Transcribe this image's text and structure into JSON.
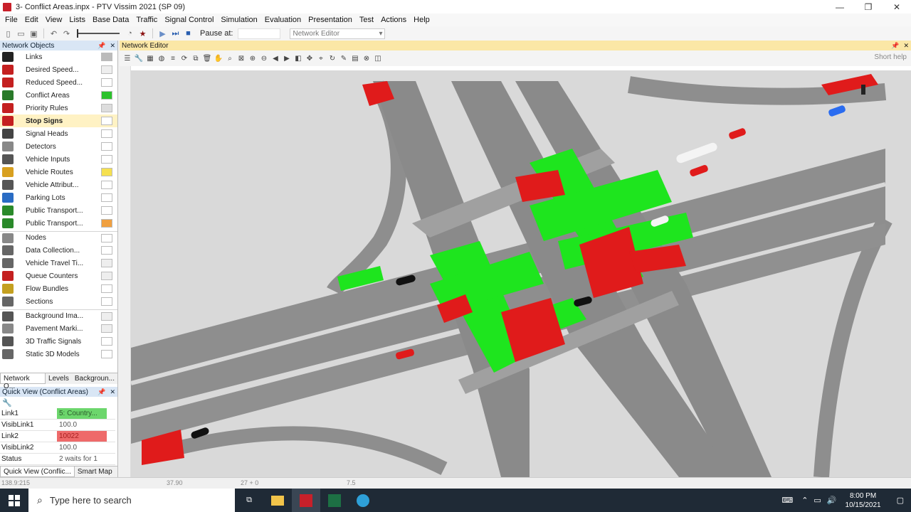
{
  "window": {
    "title": "3- Conflict Areas.inpx - PTV Vissim 2021 (SP 09)"
  },
  "menu": [
    "File",
    "Edit",
    "View",
    "Lists",
    "Base Data",
    "Traffic",
    "Signal Control",
    "Simulation",
    "Evaluation",
    "Presentation",
    "Test",
    "Actions",
    "Help"
  ],
  "toolbar": {
    "pause_label": "Pause at:",
    "editor_select": "Network Editor"
  },
  "network_objects": {
    "title": "Network Objects",
    "items": [
      {
        "label": "Links"
      },
      {
        "label": "Desired Speed..."
      },
      {
        "label": "Reduced Speed..."
      },
      {
        "label": "Conflict Areas"
      },
      {
        "label": "Priority Rules"
      },
      {
        "label": "Stop Signs"
      },
      {
        "label": "Signal Heads"
      },
      {
        "label": "Detectors"
      },
      {
        "label": "Vehicle Inputs"
      },
      {
        "label": "Vehicle Routes"
      },
      {
        "label": "Vehicle Attribut..."
      },
      {
        "label": "Parking Lots"
      },
      {
        "label": "Public Transport..."
      },
      {
        "label": "Public Transport..."
      },
      {
        "label": "Nodes"
      },
      {
        "label": "Data Collection..."
      },
      {
        "label": "Vehicle Travel Ti..."
      },
      {
        "label": "Queue Counters"
      },
      {
        "label": "Flow Bundles"
      },
      {
        "label": "Sections"
      },
      {
        "label": "Background Ima..."
      },
      {
        "label": "Pavement Marki..."
      },
      {
        "label": "3D Traffic Signals"
      },
      {
        "label": "Static 3D Models"
      }
    ],
    "tabs": [
      "Network O...",
      "Levels",
      "Backgroun..."
    ]
  },
  "quick_view": {
    "title": "Quick View (Conflict Areas)",
    "rows": [
      {
        "key": "Link1",
        "value": "5: Country..."
      },
      {
        "key": "VisibLink1",
        "value": "100.0"
      },
      {
        "key": "Link2",
        "value": "10022"
      },
      {
        "key": "VisibLink2",
        "value": "100.0"
      },
      {
        "key": "Status",
        "value": "2 waits for 1"
      }
    ],
    "tabs": [
      "Quick View (Conflic...",
      "Smart Map"
    ]
  },
  "editor": {
    "title": "Network Editor",
    "short_help": "Short help"
  },
  "statusbar": {
    "coords": "138.9:215",
    "v2": "37.90",
    "v3": "27 + 0",
    "v4": "7.5"
  },
  "taskbar": {
    "search_placeholder": "Type here to search",
    "time": "8:00 PM",
    "date": "10/15/2021"
  },
  "colors": {
    "conflict_green": "#1ee51e",
    "conflict_red": "#e01b1b",
    "road": "#8e8e8e",
    "ground": "#d9d9d9"
  }
}
